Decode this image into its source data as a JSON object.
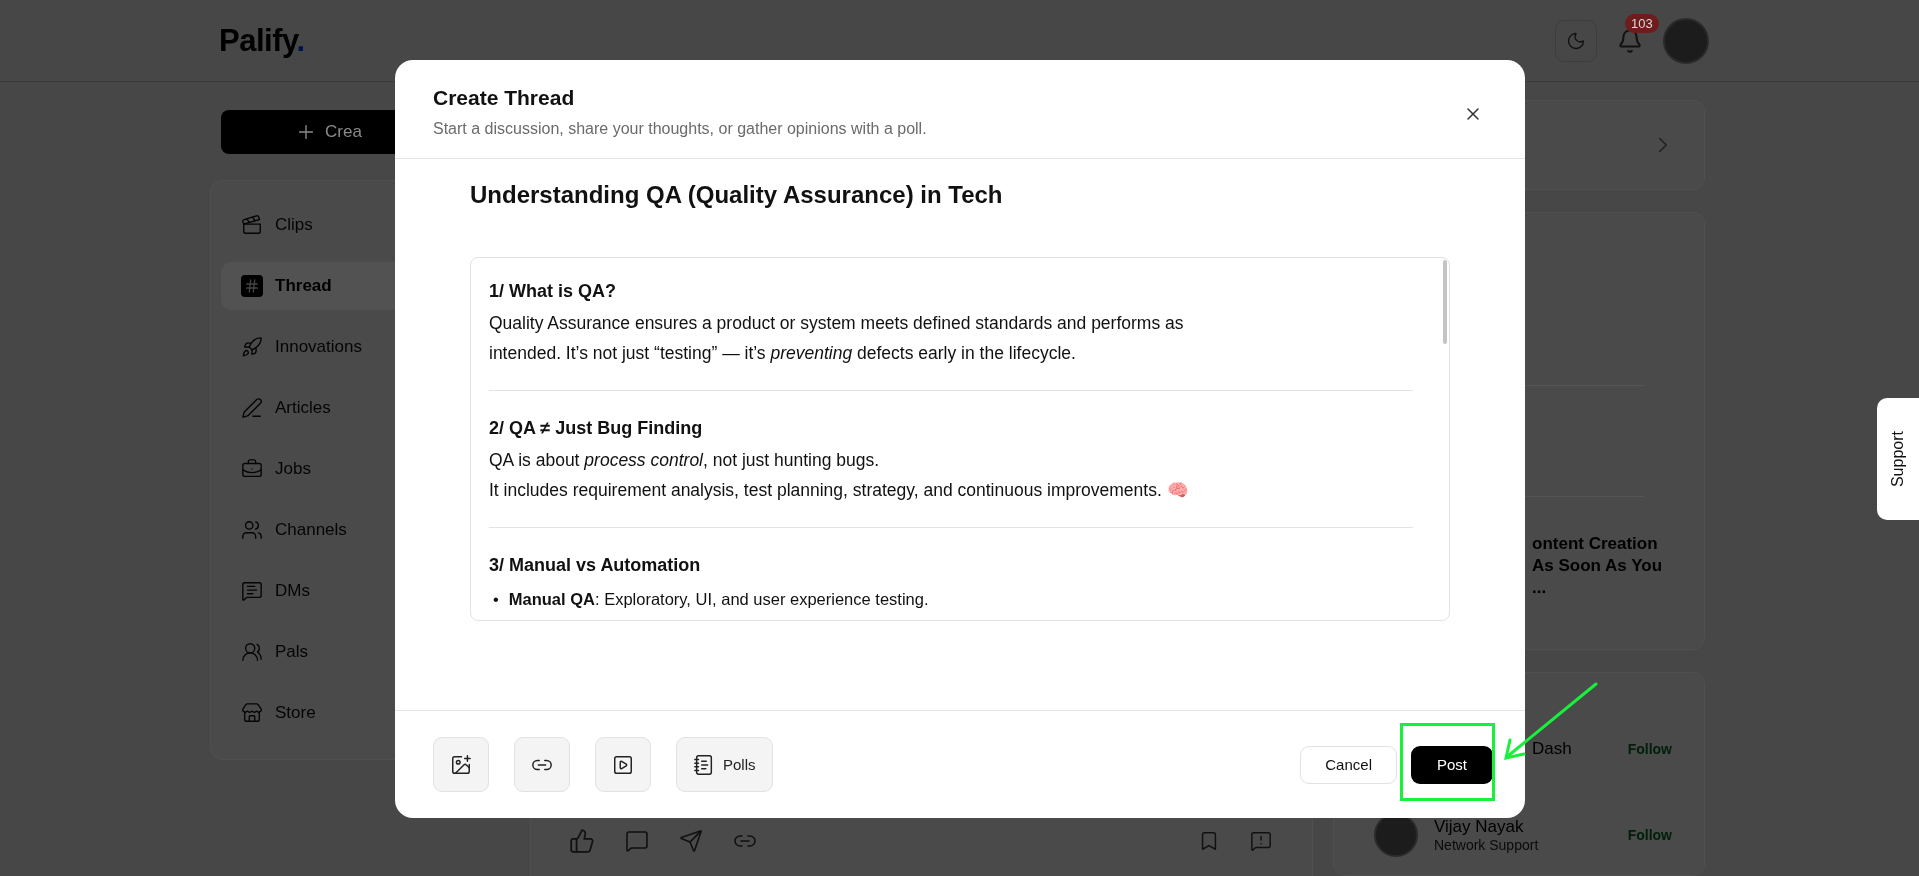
{
  "header": {
    "logo": "Palify",
    "logo_dot": ".",
    "notification_count": "103"
  },
  "sidebar": {
    "create_button": "Crea",
    "items": [
      {
        "kind": "clips",
        "label": "Clips",
        "selected": false
      },
      {
        "kind": "thread",
        "label": "Thread",
        "selected": true
      },
      {
        "kind": "innovations",
        "label": "Innovations",
        "selected": false
      },
      {
        "kind": "articles",
        "label": "Articles",
        "selected": false
      },
      {
        "kind": "jobs",
        "label": "Jobs",
        "selected": false
      },
      {
        "kind": "channels",
        "label": "Channels",
        "selected": false
      },
      {
        "kind": "dms",
        "label": "DMs",
        "selected": false
      },
      {
        "kind": "pals",
        "label": "Pals",
        "selected": false
      },
      {
        "kind": "store",
        "label": "Store",
        "selected": false
      }
    ]
  },
  "right_panel": {
    "trending_lines": [
      "ontent Creation",
      "As Soon As You",
      "..."
    ],
    "suggestions": [
      {
        "name": "Dash",
        "action": "Follow"
      },
      {
        "name": "Vijay Nayak",
        "role": "Network Support",
        "action": "Follow"
      }
    ]
  },
  "support_tab": "Support",
  "modal": {
    "title": "Create Thread",
    "subtitle": "Start a discussion, share your thoughts, or gather opinions with a poll.",
    "post_title": "Understanding QA (Quality Assurance) in Tech",
    "sections": [
      {
        "heading": "1/ What is QA?",
        "lines": [
          "Quality Assurance ensures a product or system meets defined standards and performs as",
          "intended. It’s not just “testing” — it’s *preventing* defects early in the lifecycle."
        ]
      },
      {
        "heading": "2/ QA ≠ Just Bug Finding",
        "lines": [
          "QA is about *process control*, not just hunting bugs.",
          "It includes requirement analysis, test planning, strategy, and continuous improvements. 🧠"
        ]
      },
      {
        "heading": "3/ Manual vs Automation",
        "bullet_marker": "•",
        "bullets": [
          "**Manual QA**: Exploratory, UI, and user experience testing."
        ]
      }
    ],
    "tools": [
      {
        "kind": "image"
      },
      {
        "kind": "link"
      },
      {
        "kind": "video"
      },
      {
        "kind": "polls",
        "label": "Polls"
      }
    ],
    "cancel": "Cancel",
    "post": "Post"
  }
}
